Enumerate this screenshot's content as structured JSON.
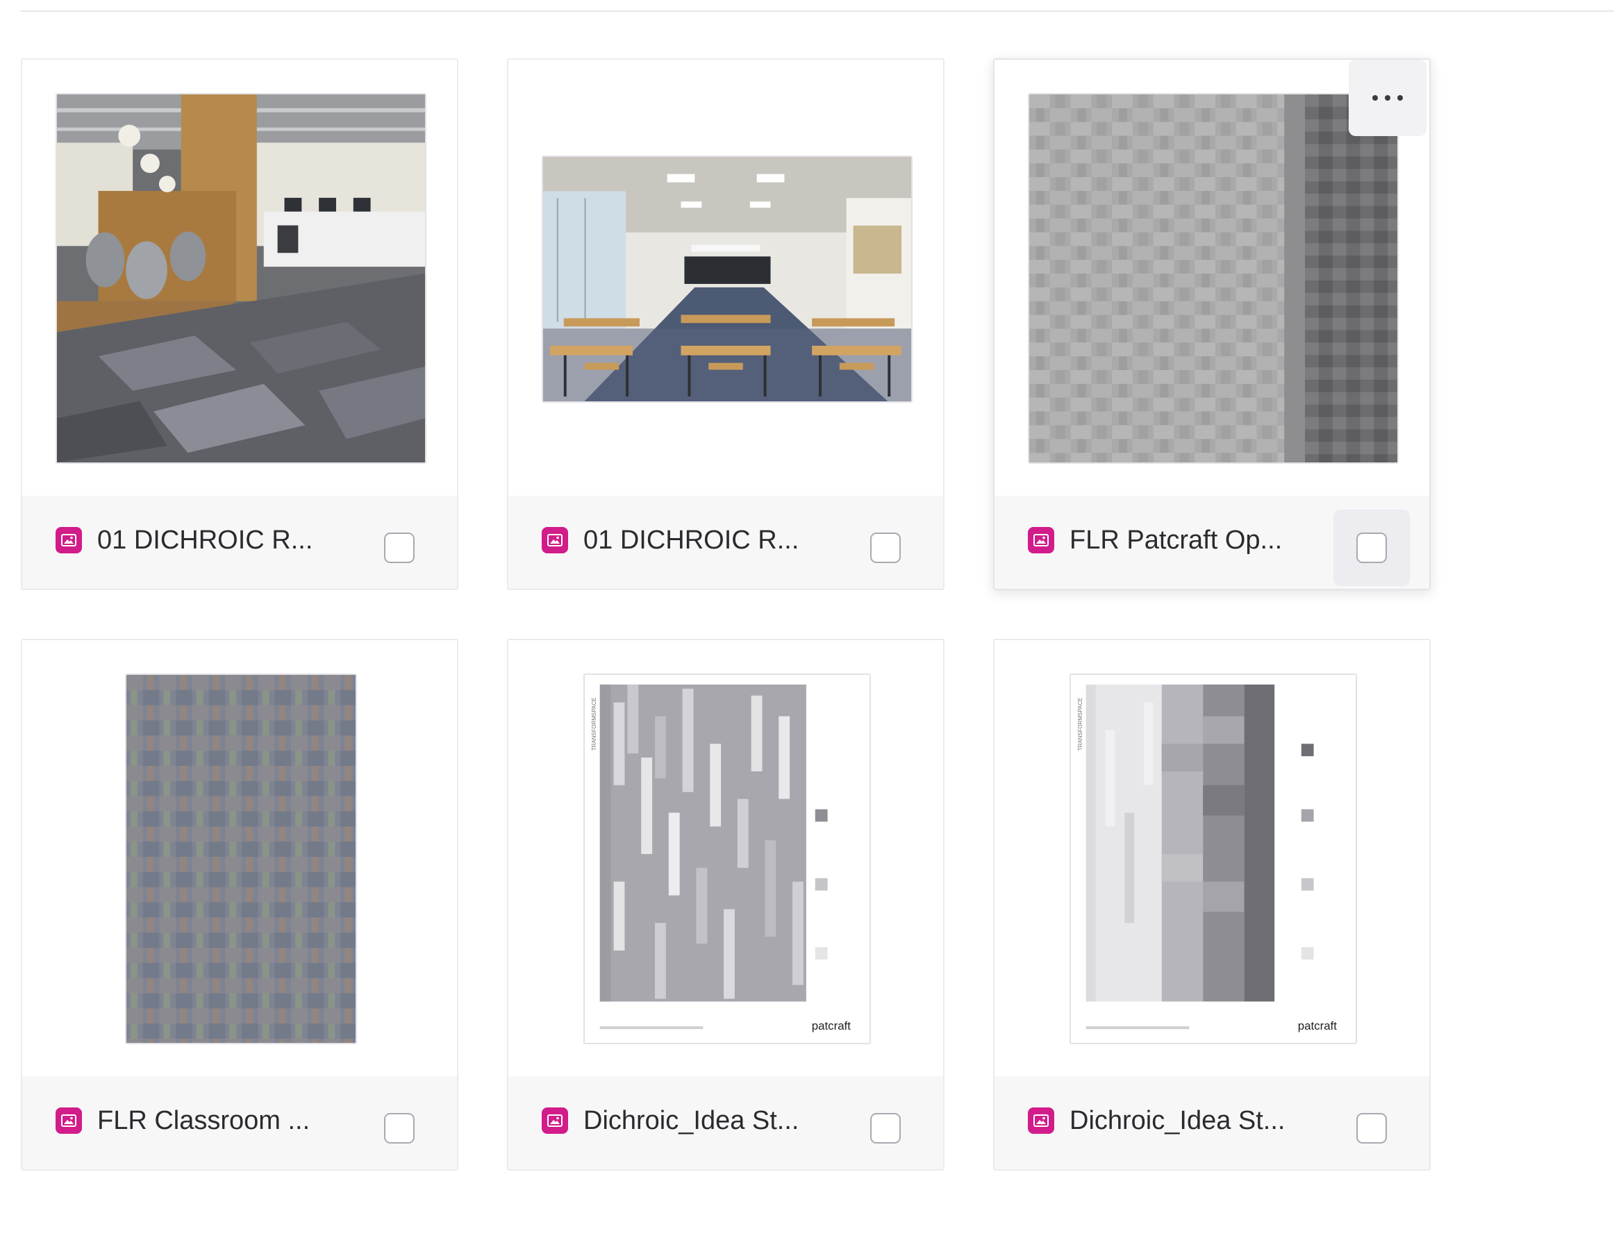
{
  "colors": {
    "accent": "#d11c8a",
    "card_border": "#ebebee",
    "footer_bg": "#f7f7f8",
    "text": "#2b2b2f"
  },
  "assets": [
    {
      "name": "01 DICHROIC R...",
      "type_icon": "image-icon",
      "thumbnail": "office-interior-carpet"
    },
    {
      "name": "01 DICHROIC R...",
      "type_icon": "image-icon",
      "thumbnail": "classroom-interior-carpet"
    },
    {
      "name": "FLR Patcraft Op...",
      "type_icon": "image-icon",
      "thumbnail": "gray-carpet-swatch",
      "more_menu_icon": "more-horizontal-icon"
    },
    {
      "name": "FLR Classroom ...",
      "type_icon": "image-icon",
      "thumbnail": "multicolor-carpet-swatch"
    },
    {
      "name": "Dichroic_Idea St...",
      "type_icon": "image-icon",
      "thumbnail": "installation-layout-sheet",
      "sheet_vertical_text": "TRANSFORMSPACE",
      "sheet_brand": "patcraft"
    },
    {
      "name": "Dichroic_Idea St...",
      "type_icon": "image-icon",
      "thumbnail": "installation-layout-sheet",
      "sheet_vertical_text": "TRANSFORMSPACE",
      "sheet_brand": "patcraft"
    }
  ]
}
